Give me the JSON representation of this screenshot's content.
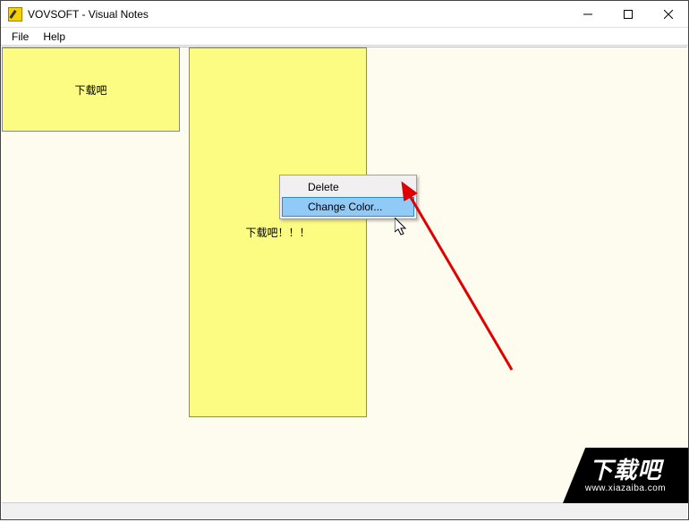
{
  "window": {
    "title": "VOVSOFT - Visual Notes"
  },
  "menubar": {
    "file": "File",
    "help": "Help"
  },
  "notes": {
    "note1_text": "下载吧",
    "note2_text": "下载吧！！！"
  },
  "context_menu": {
    "delete": "Delete",
    "change_color": "Change Color..."
  },
  "watermark": {
    "big": "下载吧",
    "small": "www.xiazaiba.com"
  }
}
